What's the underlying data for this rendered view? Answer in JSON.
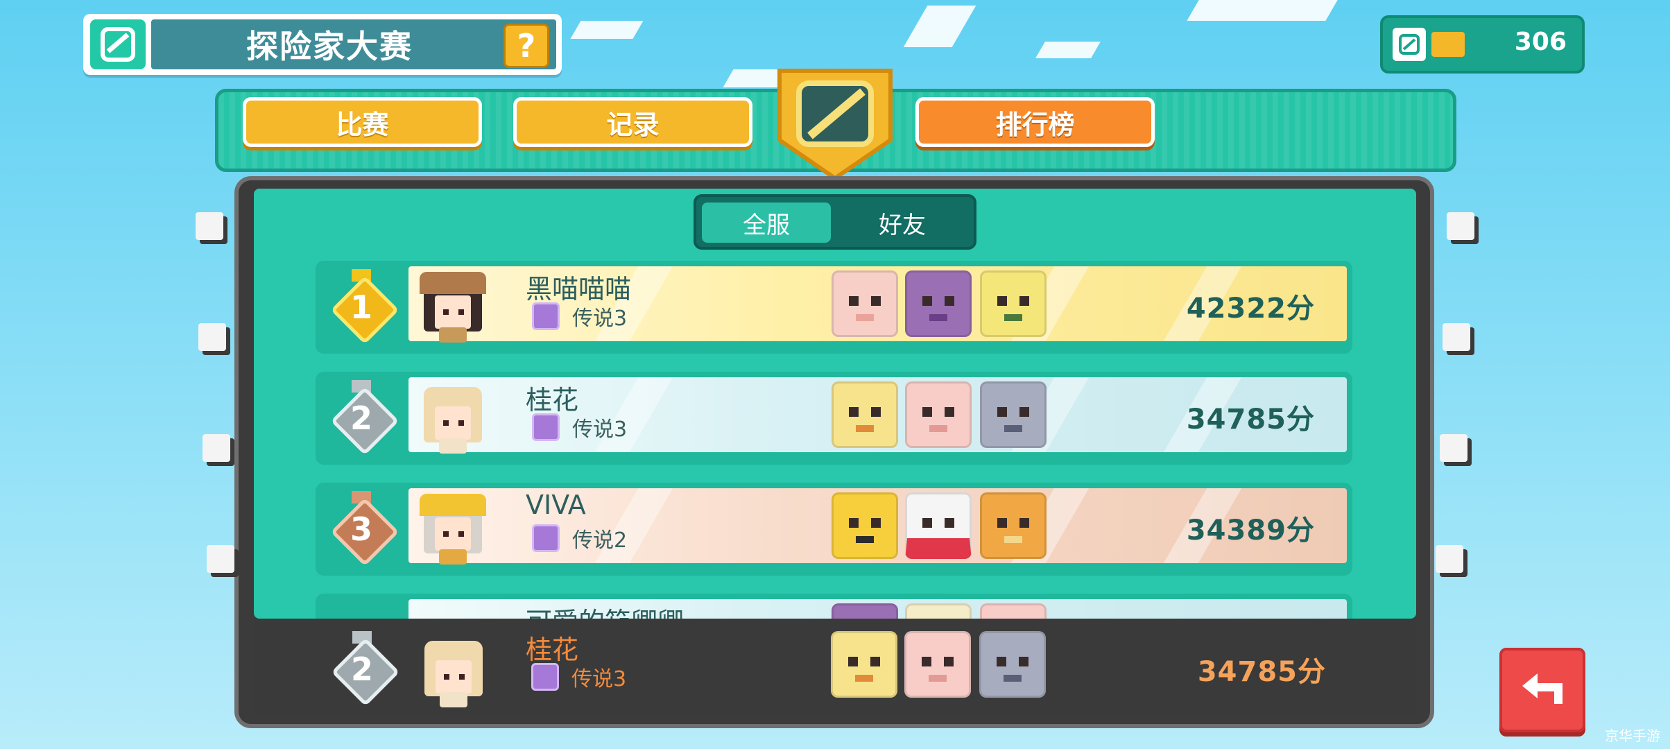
{
  "header": {
    "title": "探险家大赛",
    "help_label": "?",
    "currency_value": "306"
  },
  "tabs": [
    {
      "label": "比赛",
      "active": false
    },
    {
      "label": "记录",
      "active": false
    },
    {
      "label": "排行榜",
      "active": true
    }
  ],
  "scope_toggle": {
    "options": [
      "全服",
      "好友"
    ],
    "selected": "全服"
  },
  "leaderboard": [
    {
      "rank": "1",
      "name": "黑喵喵喵",
      "tier": "传说3",
      "score": "42322分",
      "tier_color": "#f2c31b",
      "team": [
        "pig-mon",
        "purple-mon",
        "green-mon"
      ]
    },
    {
      "rank": "2",
      "name": "桂花",
      "tier": "传说3",
      "score": "34785分",
      "tier_color": "#b9c2c6",
      "team": [
        "yellow-mon",
        "pink-mon",
        "gray-mon"
      ]
    },
    {
      "rank": "3",
      "name": "VIVA",
      "tier": "传说2",
      "score": "34389分",
      "tier_color": "#d99672",
      "team": [
        "yellow-black-mon",
        "white-red-mon",
        "orange-mon"
      ]
    },
    {
      "rank": "",
      "name": "可爱的笳卿卿",
      "tier": "",
      "score": "",
      "tier_color": "#29c7ab",
      "team": [
        "purple-mon",
        "cream-mon",
        "pink-mon"
      ]
    }
  ],
  "self_entry": {
    "rank": "2",
    "name": "桂花",
    "tier": "传说3",
    "score": "34785分"
  },
  "colors": {
    "accent": "#29c7ab",
    "tab": "#f5b82a",
    "tab_active": "#f88b2b",
    "back_button": "#ee4a4a"
  },
  "watermark": "京华手游"
}
